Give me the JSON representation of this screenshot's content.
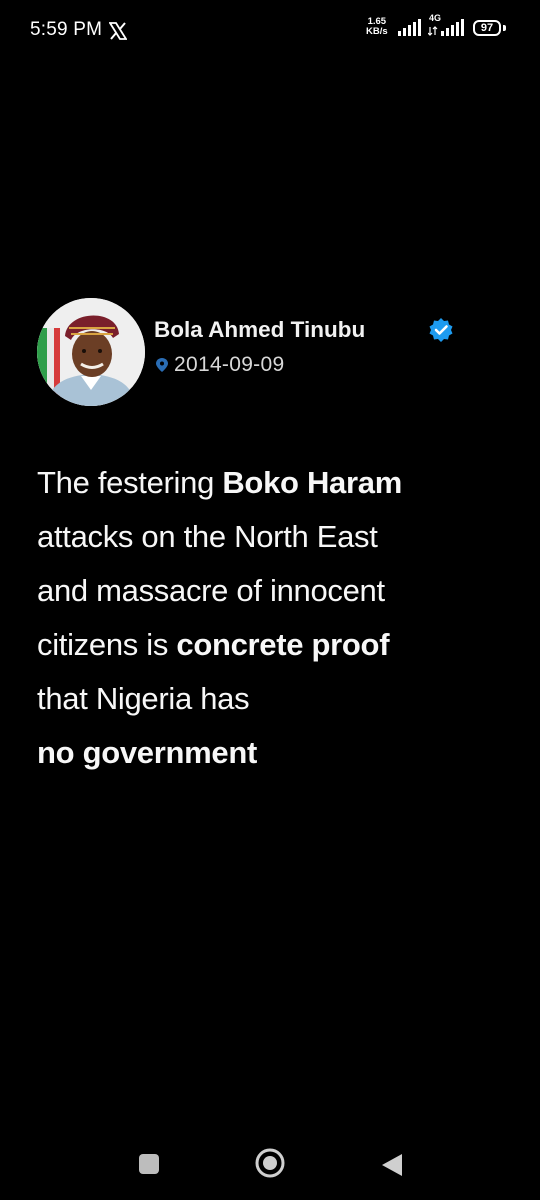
{
  "status_bar": {
    "time": "5:59 PM",
    "net_speed_value": "1.65",
    "net_speed_unit": "KB/s",
    "network_type": "4G",
    "battery": "97",
    "icons": [
      "x-logo-icon",
      "signal-icon",
      "signal-4g-icon",
      "battery-icon"
    ]
  },
  "tweet": {
    "author": "Bola Ahmed Tinubu",
    "date": "2014-09-09",
    "verified_color": "#1d9bf0",
    "lines": [
      [
        "The festering ",
        "Boko Haram"
      ],
      [
        "attacks on the North East",
        ""
      ],
      [
        "and massacre of innocent",
        ""
      ],
      [
        "citizens is ",
        "concrete proof"
      ],
      [
        "that Nigeria has",
        ""
      ],
      [
        "",
        "no government"
      ]
    ]
  },
  "nav_bar": {
    "icons": [
      "recents-square-icon",
      "home-circle-icon",
      "back-triangle-icon"
    ]
  }
}
